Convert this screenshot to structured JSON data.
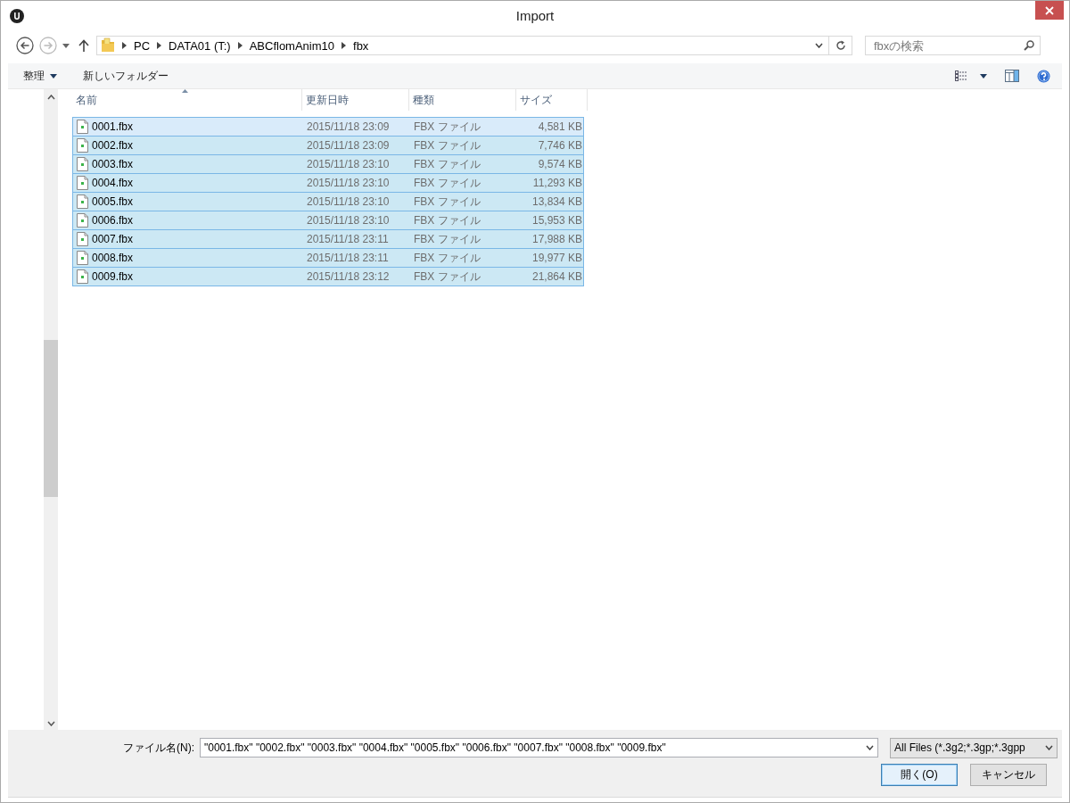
{
  "window": {
    "title": "Import"
  },
  "address_bar": {
    "segments": [
      "PC",
      "DATA01 (T:)",
      "ABCflomAnim10",
      "fbx"
    ]
  },
  "search": {
    "placeholder": "fbxの検索"
  },
  "toolbar": {
    "organize": "整理",
    "new_folder": "新しいフォルダー"
  },
  "columns": [
    {
      "label": "名前",
      "sorted": true
    },
    {
      "label": "更新日時",
      "sorted": false
    },
    {
      "label": "種類",
      "sorted": false
    },
    {
      "label": "サイズ",
      "sorted": false
    }
  ],
  "files": [
    {
      "name": "0001.fbx",
      "modified": "2015/11/18 23:09",
      "type": "FBX ファイル",
      "size": "4,581 KB",
      "selected": true,
      "focused": true
    },
    {
      "name": "0002.fbx",
      "modified": "2015/11/18 23:09",
      "type": "FBX ファイル",
      "size": "7,746 KB",
      "selected": true,
      "focused": false
    },
    {
      "name": "0003.fbx",
      "modified": "2015/11/18 23:10",
      "type": "FBX ファイル",
      "size": "9,574 KB",
      "selected": true,
      "focused": false
    },
    {
      "name": "0004.fbx",
      "modified": "2015/11/18 23:10",
      "type": "FBX ファイル",
      "size": "11,293 KB",
      "selected": true,
      "focused": false
    },
    {
      "name": "0005.fbx",
      "modified": "2015/11/18 23:10",
      "type": "FBX ファイル",
      "size": "13,834 KB",
      "selected": true,
      "focused": false
    },
    {
      "name": "0006.fbx",
      "modified": "2015/11/18 23:10",
      "type": "FBX ファイル",
      "size": "15,953 KB",
      "selected": true,
      "focused": false
    },
    {
      "name": "0007.fbx",
      "modified": "2015/11/18 23:11",
      "type": "FBX ファイル",
      "size": "17,988 KB",
      "selected": true,
      "focused": false
    },
    {
      "name": "0008.fbx",
      "modified": "2015/11/18 23:11",
      "type": "FBX ファイル",
      "size": "19,977 KB",
      "selected": true,
      "focused": false
    },
    {
      "name": "0009.fbx",
      "modified": "2015/11/18 23:12",
      "type": "FBX ファイル",
      "size": "21,864 KB",
      "selected": true,
      "focused": false
    }
  ],
  "file_name": {
    "label": "ファイル名(N):",
    "value": "\"0001.fbx\" \"0002.fbx\" \"0003.fbx\" \"0004.fbx\" \"0005.fbx\" \"0006.fbx\" \"0007.fbx\" \"0008.fbx\" \"0009.fbx\""
  },
  "file_type": {
    "value": "All Files (*.3g2;*.3gp;*.3gpp"
  },
  "buttons": [
    {
      "label": "開く(O)",
      "default": true
    },
    {
      "label": "キャンセル",
      "default": false
    }
  ]
}
